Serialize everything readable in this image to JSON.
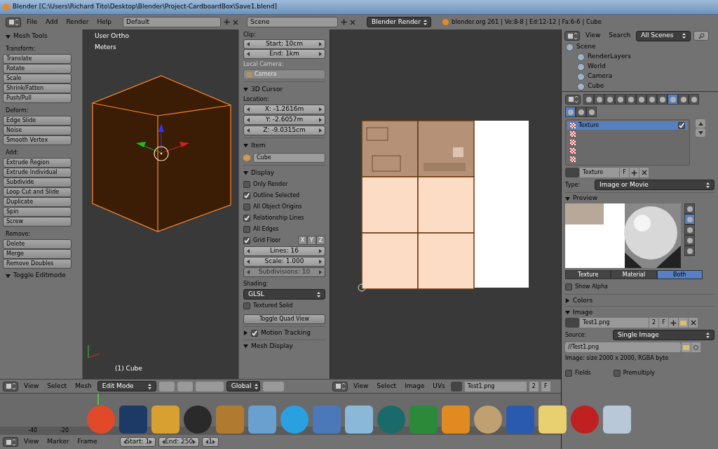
{
  "window": {
    "title": "Blender [C:\\Users\\Richard Tito\\Desktop\\Blender\\Project-CardboardBox\\Save1.blend]"
  },
  "info_header": {
    "menus": [
      "File",
      "Add",
      "Render",
      "Help"
    ],
    "layout": "Default",
    "scene": "Scene",
    "engine": "Blender Render",
    "stats": "blender.org 261 | Ve:8-8 | Ed:12-12 | Fa:6-6 | Cube"
  },
  "tool_shelf": {
    "title": "Mesh Tools",
    "expanded": true,
    "groups": [
      {
        "label": "Transform:",
        "buttons": [
          "Translate",
          "Rotate",
          "Scale",
          "Shrink/Fatten",
          "Push/Pull"
        ]
      },
      {
        "label": "Deform:",
        "buttons": [
          "Edge Slide",
          "Noise",
          "Smooth Vertex"
        ]
      },
      {
        "label": "Add:",
        "buttons": [
          "Extrude Region",
          "Extrude Individual",
          "Subdivide",
          "Loop Cut and Slide",
          "Duplicate",
          "Spin",
          "Screw"
        ]
      },
      {
        "label": "Remove:",
        "buttons": [
          "Delete",
          "Merge",
          "Remove Doubles"
        ]
      }
    ],
    "footer": {
      "title": "Toggle Editmode",
      "expanded": true
    }
  },
  "viewport": {
    "view": "User Ortho",
    "units": "Meters",
    "object": "(1) Cube"
  },
  "n_panel": {
    "clip": {
      "label": "Clip:",
      "start": "Start: 10cm",
      "end": "End: 1km",
      "local_camera": "Local Camera:",
      "camera": "Camera"
    },
    "cursor": {
      "title": "3D Cursor",
      "expanded": true,
      "label": "Location:",
      "fields": [
        "X: -1.2616m",
        "Y: -2.6057m",
        "Z: -9.0315cm"
      ]
    },
    "item": {
      "title": "Item",
      "expanded": true,
      "name": "Cube"
    },
    "display": {
      "title": "Display",
      "expanded": true,
      "options": [
        {
          "label": "Only Render",
          "checked": false
        },
        {
          "label": "Outline Selected",
          "checked": true
        },
        {
          "label": "All Object Origins",
          "checked": false
        },
        {
          "label": "Relationship Lines",
          "checked": true
        },
        {
          "label": "All Edges",
          "checked": false
        }
      ],
      "grid_floor": {
        "label": "Grid Floor",
        "checked": true,
        "axes": [
          "X",
          "Y",
          "Z"
        ]
      },
      "lines": "Lines: 16",
      "scale": "Scale: 1.000",
      "subdivisions": "Subdivisions: 10",
      "shading_label": "Shading:",
      "shading": "GLSL",
      "textured_solid": {
        "label": "Textured Solid",
        "checked": false
      },
      "quad_view": "Toggle Quad View"
    },
    "panels": [
      {
        "title": "Motion Tracking",
        "expanded": false,
        "checked": true
      },
      {
        "title": "Mesh Display",
        "expanded": true
      }
    ]
  },
  "view3d_header": {
    "menus": [
      "View",
      "Select",
      "Mesh"
    ],
    "mode": "Edit Mode",
    "orientation": "Global"
  },
  "uv_header": {
    "menus": [
      "View",
      "Select",
      "Image",
      "UVs"
    ],
    "image": "Test1.png",
    "users": "2",
    "fake": "F"
  },
  "timeline": {
    "ruler": [
      "-40",
      "-20"
    ],
    "menus": [
      "View",
      "Marker",
      "Frame"
    ],
    "start": "Start: 1",
    "end": "End: 250",
    "current": "1"
  },
  "outliner": {
    "menus": [
      "View",
      "Search"
    ],
    "filter": "All Scenes",
    "tree": [
      {
        "name": "Scene",
        "children": [
          {
            "name": "RenderLayers"
          },
          {
            "name": "World"
          },
          {
            "name": "Camera"
          },
          {
            "name": "Cube"
          }
        ]
      }
    ]
  },
  "properties": {
    "tabs": [
      {
        "selected": false
      },
      {
        "selected": false
      },
      {
        "selected": false
      },
      {
        "selected": false
      },
      {
        "selected": false
      },
      {
        "selected": false
      },
      {
        "selected": false
      },
      {
        "selected": false
      },
      {
        "selected": true
      },
      {
        "selected": false
      },
      {
        "selected": false
      }
    ],
    "contexts": [
      {
        "selected": true
      },
      {
        "selected": false
      },
      {
        "selected": false
      }
    ],
    "slots": [
      {
        "name": "Texture",
        "selected": true,
        "checked": true
      },
      {
        "selected": false
      },
      {
        "selected": false
      },
      {
        "selected": false
      },
      {
        "selected": false
      }
    ],
    "texture": {
      "name": "Texture",
      "fake": "F",
      "type_label": "Type:",
      "type": "Image or Movie"
    },
    "preview": {
      "title": "Preview",
      "expanded": true,
      "shapes": [
        {
          "selected": false
        },
        {
          "selected": true
        },
        {
          "selected": false
        },
        {
          "selected": false
        },
        {
          "selected": false
        }
      ],
      "modes": [
        {
          "label": "Texture",
          "selected": false
        },
        {
          "label": "Material",
          "selected": false
        },
        {
          "label": "Both",
          "selected": true
        }
      ],
      "show_alpha": {
        "label": "Show Alpha",
        "checked": false
      }
    },
    "colors": {
      "title": "Colors",
      "expanded": false
    },
    "image": {
      "title": "Image",
      "expanded": true,
      "name": "Test1.png",
      "users": "2",
      "fake": "F",
      "source_label": "Source:",
      "source": "Single Image",
      "path": "//Test1.png",
      "info": "Image: size 2000 x 2000, RGBA byte",
      "fields": {
        "label": "Fields",
        "checked": false
      },
      "premultiply": {
        "label": "Premultiply",
        "checked": false
      }
    }
  }
}
